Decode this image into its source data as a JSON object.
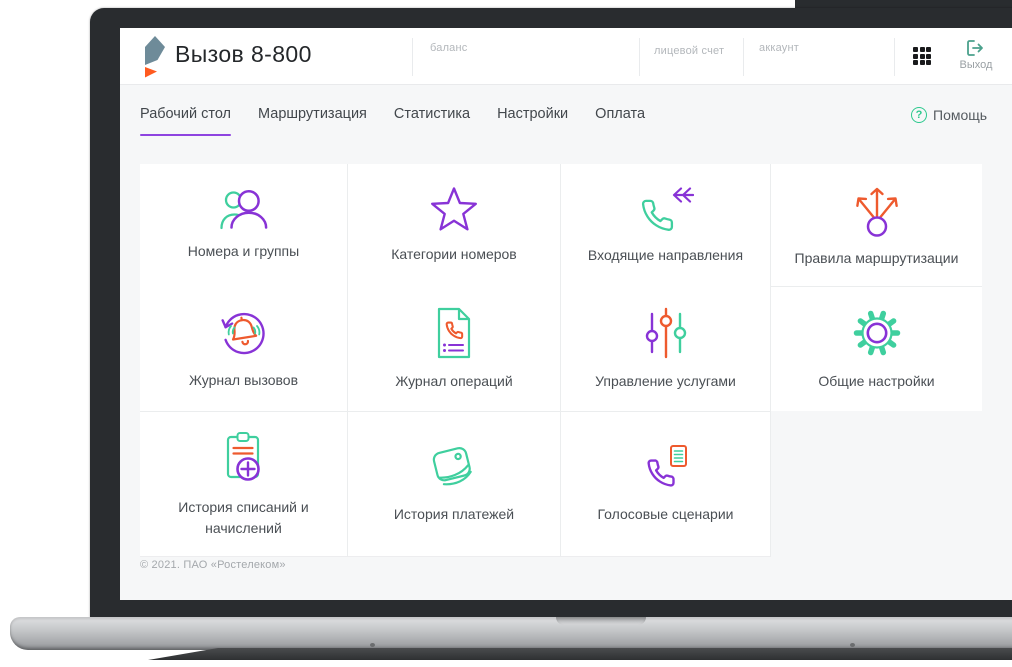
{
  "colors": {
    "accent_purple": "#8e44e0",
    "icon_purple": "#8833d6",
    "icon_green": "#3fcf9e",
    "icon_orange": "#ee5a2e",
    "brand_slate": "#6e8b99",
    "brand_orange": "#ff5a1f",
    "logout_teal": "#4aa18c",
    "help_green": "#2dc98e"
  },
  "header": {
    "app_title": "Вызов 8-800",
    "balance_label": "баланс",
    "personal_account_label": "лицевой счет",
    "account_label": "аккаунт",
    "logout_label": "Выход"
  },
  "nav": {
    "tabs": [
      "Рабочий стол",
      "Маршрутизация",
      "Статистика",
      "Настройки",
      "Оплата"
    ],
    "active_tab": "Рабочий стол",
    "help_label": "Помощь"
  },
  "tiles": [
    {
      "label": "Номера и группы",
      "icon": "users-icon"
    },
    {
      "label": "Категории номеров",
      "icon": "star-icon"
    },
    {
      "label": "Входящие направления",
      "icon": "incoming-call-icon"
    },
    {
      "label": "Правила маршрутизации",
      "icon": "routing-rules-icon"
    },
    {
      "label": "Журнал вызовов",
      "icon": "call-journal-icon"
    },
    {
      "label": "Журнал операций",
      "icon": "operations-journal-icon"
    },
    {
      "label": "Управление услугами",
      "icon": "services-sliders-icon"
    },
    {
      "label": "Общие настройки",
      "icon": "settings-gear-icon"
    },
    {
      "label": "История списаний и начислений",
      "icon": "charges-history-icon"
    },
    {
      "label": "История платежей",
      "icon": "payments-wallet-icon"
    },
    {
      "label": "Голосовые сценарии",
      "icon": "voice-scenarios-icon"
    }
  ],
  "footer": {
    "copyright": "© 2021. ПАО «Ростелеком»"
  }
}
